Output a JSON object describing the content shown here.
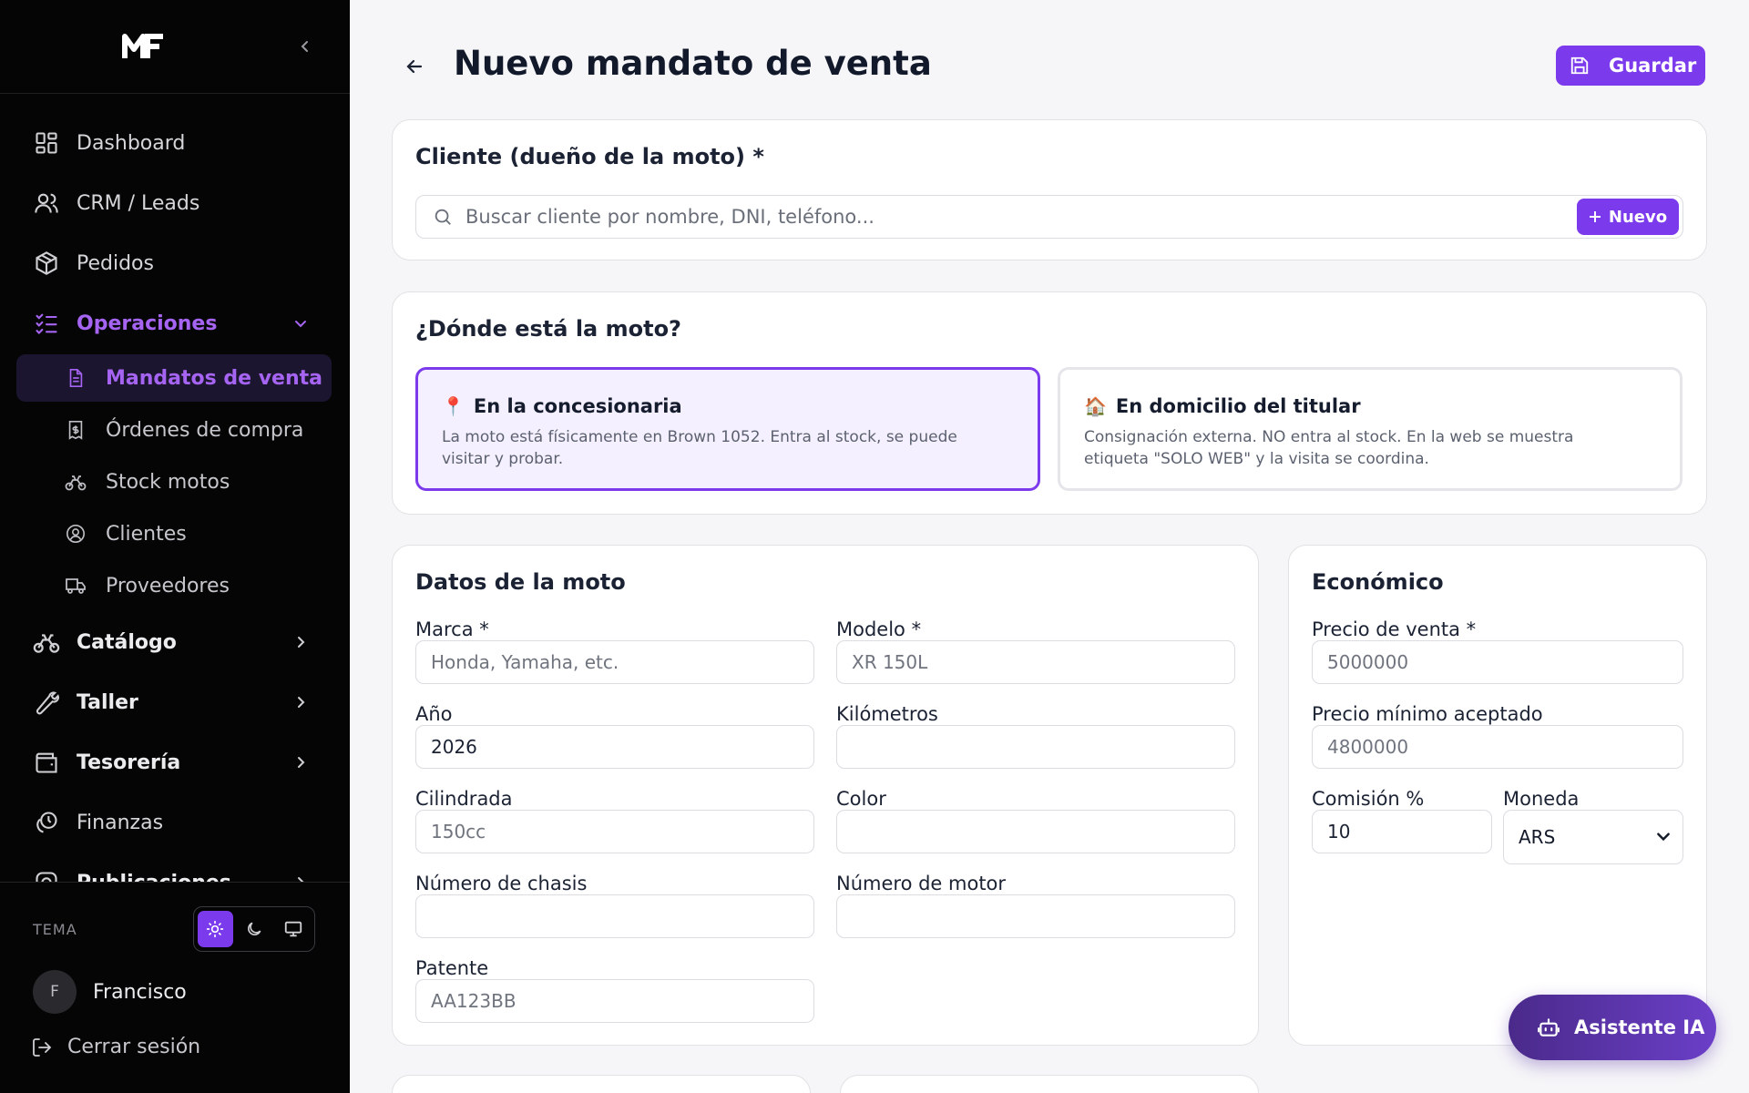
{
  "sidebar": {
    "logo_text": "MF",
    "nav": [
      {
        "label": "Dashboard"
      },
      {
        "label": "CRM / Leads"
      },
      {
        "label": "Pedidos"
      },
      {
        "label": "Operaciones"
      }
    ],
    "sub": [
      {
        "label": "Mandatos de venta"
      },
      {
        "label": "Órdenes de compra"
      },
      {
        "label": "Stock motos"
      },
      {
        "label": "Clientes"
      },
      {
        "label": "Proveedores"
      }
    ],
    "nav2": [
      {
        "label": "Catálogo"
      },
      {
        "label": "Taller"
      },
      {
        "label": "Tesorería"
      },
      {
        "label": "Finanzas"
      },
      {
        "label": "Publicaciones"
      }
    ],
    "theme_label": "TEMA",
    "user_initial": "F",
    "user_name": "Francisco",
    "logout_label": "Cerrar sesión"
  },
  "header": {
    "title": "Nuevo mandato de venta",
    "save_label": "Guardar"
  },
  "client_card": {
    "title": "Cliente (dueño de la moto) *",
    "search_placeholder": "Buscar cliente por nombre, DNI, teléfono...",
    "new_label": "Nuevo"
  },
  "location_card": {
    "title": "¿Dónde está la moto?",
    "options": [
      {
        "emoji": "📍",
        "title": "En la concesionaria",
        "desc": "La moto está físicamente en Brown 1052. Entra al stock, se puede visitar y probar."
      },
      {
        "emoji": "🏠",
        "title": "En domicilio del titular",
        "desc": "Consignación externa. NO entra al stock. En la web se muestra etiqueta \"SOLO WEB\" y la visita se coordina."
      }
    ]
  },
  "moto_card": {
    "title": "Datos de la moto",
    "fields": {
      "marca": {
        "label": "Marca *",
        "placeholder": "Honda, Yamaha, etc.",
        "value": ""
      },
      "modelo": {
        "label": "Modelo *",
        "placeholder": "XR 150L",
        "value": ""
      },
      "anio": {
        "label": "Año",
        "placeholder": "",
        "value": "2026"
      },
      "km": {
        "label": "Kilómetros",
        "placeholder": "",
        "value": ""
      },
      "cilindrada": {
        "label": "Cilindrada",
        "placeholder": "150cc",
        "value": ""
      },
      "color": {
        "label": "Color",
        "placeholder": "",
        "value": ""
      },
      "chasis": {
        "label": "Número de chasis",
        "placeholder": "",
        "value": ""
      },
      "motor": {
        "label": "Número de motor",
        "placeholder": "",
        "value": ""
      },
      "patente": {
        "label": "Patente",
        "placeholder": "AA123BB",
        "value": ""
      }
    }
  },
  "eco_card": {
    "title": "Económico",
    "fields": {
      "precio": {
        "label": "Precio de venta *",
        "placeholder": "5000000",
        "value": ""
      },
      "minimo": {
        "label": "Precio mínimo aceptado",
        "placeholder": "4800000",
        "value": ""
      },
      "comision": {
        "label": "Comisión %",
        "placeholder": "",
        "value": "10"
      },
      "moneda": {
        "label": "Moneda",
        "value": "ARS"
      }
    }
  },
  "assistant": {
    "label": "Asistente IA"
  },
  "colors": {
    "accent": "#7c3aed",
    "sidebar_bg": "#050505",
    "page_bg": "#f6f6f8"
  }
}
